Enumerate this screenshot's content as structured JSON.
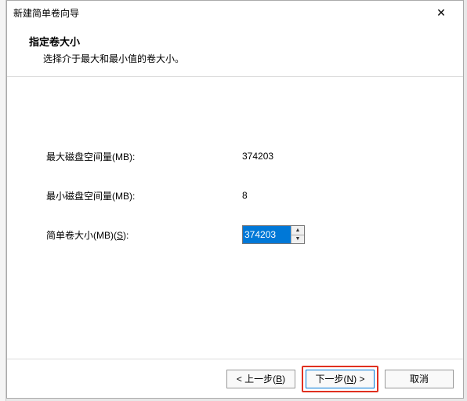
{
  "window": {
    "title": "新建简单卷向导"
  },
  "header": {
    "heading": "指定卷大小",
    "subheading": "选择介于最大和最小值的卷大小。"
  },
  "fields": {
    "max_label": "最大磁盘空间量(MB):",
    "max_value": "374203",
    "min_label": "最小磁盘空间量(MB):",
    "min_value": "8",
    "size_label_pre": "简单卷大小(MB)(",
    "size_label_hot": "S",
    "size_label_post": "):",
    "size_value": "374203"
  },
  "buttons": {
    "back_pre": "< 上一步(",
    "back_hot": "B",
    "back_post": ")",
    "next_pre": "下一步(",
    "next_hot": "N",
    "next_post": ") >",
    "cancel": "取消"
  }
}
